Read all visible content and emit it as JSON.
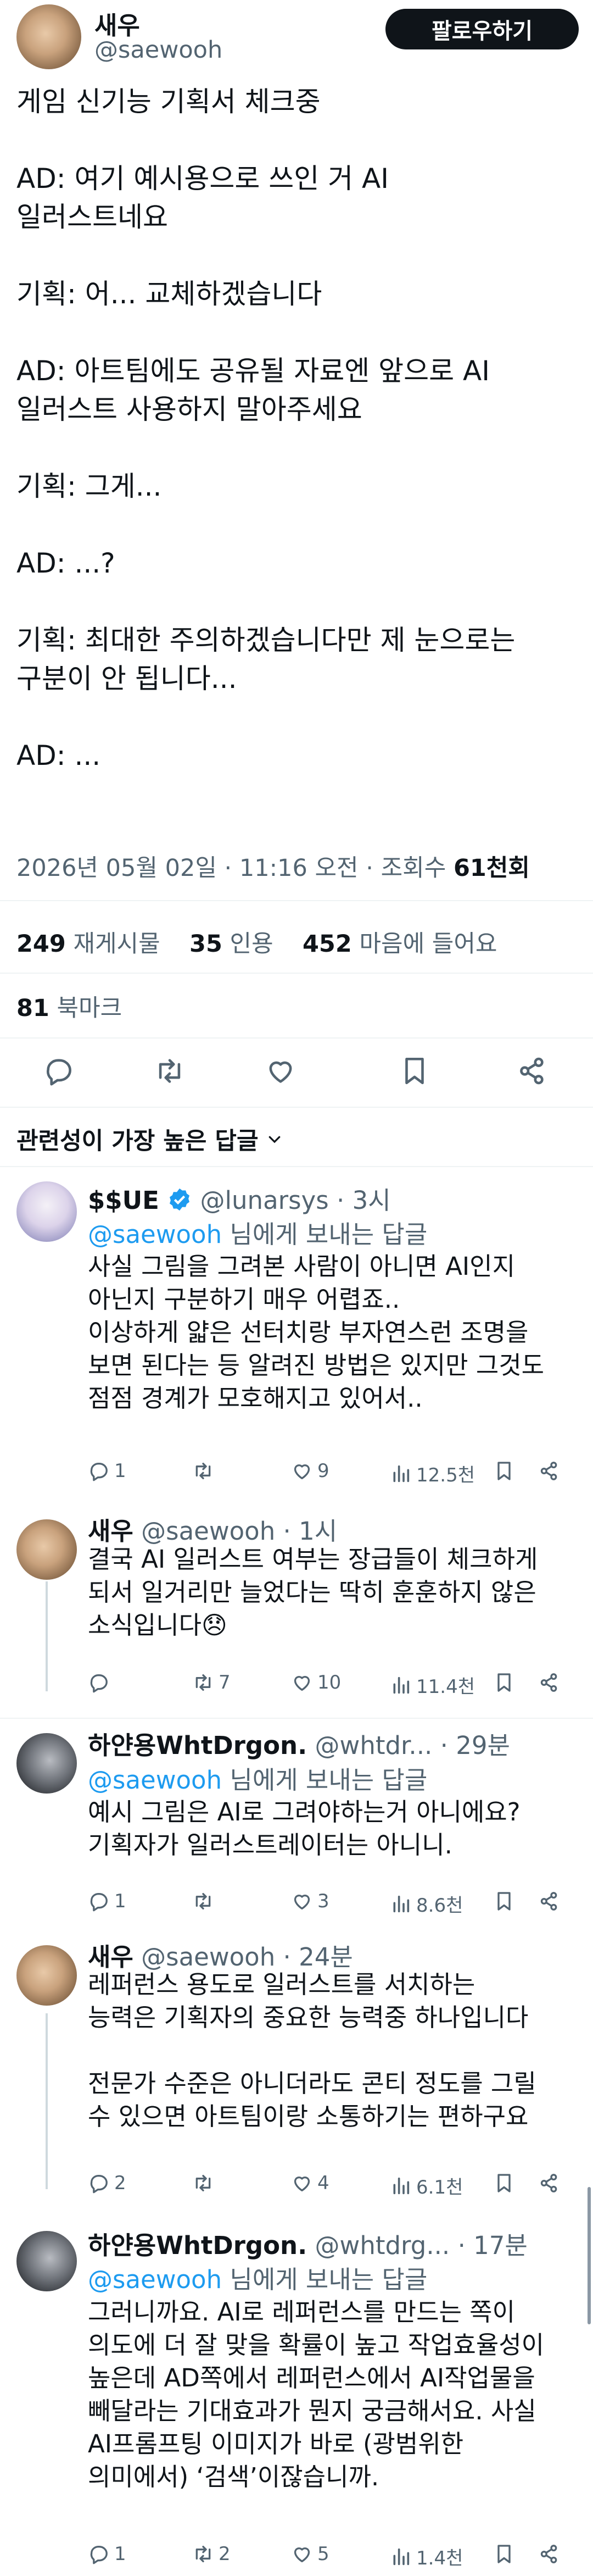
{
  "main_tweet": {
    "author_name": "새우",
    "handle": "@saewooh",
    "follow_button": "팔로우하기",
    "lines": [
      "게임 신기능 기획서 체크중",
      "AD: 여기 예시용으로 쓰인 거 AI",
      "일러스트네요",
      "기획: 어... 교체하겠습니다",
      "AD: 아트팀에도 공유될 자료엔 앞으로 AI",
      "일러스트 사용하지 말아주세요",
      "기획: 그게...",
      "AD: ...?",
      "기획: 최대한 주의하겠습니다만 제 눈으로는",
      "구분이 안 됩니다...",
      "AD: ..."
    ],
    "timestamp": "2026년 05월 02일 · 11:16 오전 · 조회수 ",
    "views": "61천회",
    "retweets_count": "249",
    "retweets_label": "재게시물",
    "quotes_count": "35",
    "quotes_label": "인용",
    "likes_count": "452",
    "likes_label": "마음에 들어요",
    "bookmarks_count": "81",
    "bookmarks_label": "북마크"
  },
  "sort_label": "관련성이 가장 높은 답글",
  "reply_to_prefix": "@saewooh",
  "reply_to_suffix": " 님에게 보내는 답글",
  "replies": [
    {
      "name": "$$UE",
      "handle": "@lunarsys",
      "time": "· 3시",
      "text": "사실 그림을 그려본 사람이 아니면 AI인지\n아닌지 구분하기 매우 어렵죠..\n이상하게 얇은 선터치랑 부자연스런 조명을\n보면 된다는 등 알려진 방법은 있지만 그것도\n점점 경계가 모호해지고 있어서..",
      "replies": "1",
      "retweets": "",
      "likes": "9",
      "views": "12.5천"
    },
    {
      "name": "새우",
      "handle": "@saewooh",
      "time": "· 1시",
      "text": "결국 AI 일러스트 여부는 장급들이 체크하게\n되서 일거리만 늘었다는 딱히 훈훈하지 않은\n소식입니다😞",
      "replies": "",
      "retweets": "7",
      "likes": "10",
      "views": "11.4천"
    },
    {
      "name": "하얀용WhtDrgon.",
      "handle": "@whtdr...",
      "time": "· 29분",
      "text": "예시 그림은 AI로 그려야하는거 아니에요?\n기획자가 일러스트레이터는 아니니.",
      "replies": "1",
      "retweets": "",
      "likes": "3",
      "views": "8.6천"
    },
    {
      "name": "새우",
      "handle": "@saewooh",
      "time": "· 24분",
      "text": "레퍼런스 용도로 일러스트를 서치하는\n능력은 기획자의 중요한 능력중 하나입니다\n\n전문가 수준은 아니더라도 콘티 정도를 그릴\n수 있으면 아트팀이랑 소통하기는 편하구요",
      "replies": "2",
      "retweets": "",
      "likes": "4",
      "views": "6.1천"
    },
    {
      "name": "하얀용WhtDrgon.",
      "handle": "@whtdrg...",
      "time": "· 17분",
      "text": "그러니까요. AI로 레퍼런스를 만드는 쪽이\n의도에 더 잘 맞을 확률이 높고 작업효율성이\n높은데 AD쪽에서 레퍼런스에서 AI작업물을\n빼달라는 기대효과가 뭔지 궁금해서요. 사실\nAI프롬프팅 이미지가 바로 (광범위한\n의미에서) ‘검색’이잖습니까.",
      "replies": "1",
      "retweets": "2",
      "likes": "5",
      "views": "1.4천"
    }
  ],
  "colors": {
    "accent": "#1d9bf0",
    "muted": "#536471",
    "divider": "#eff3f4",
    "text": "#0f1419"
  }
}
